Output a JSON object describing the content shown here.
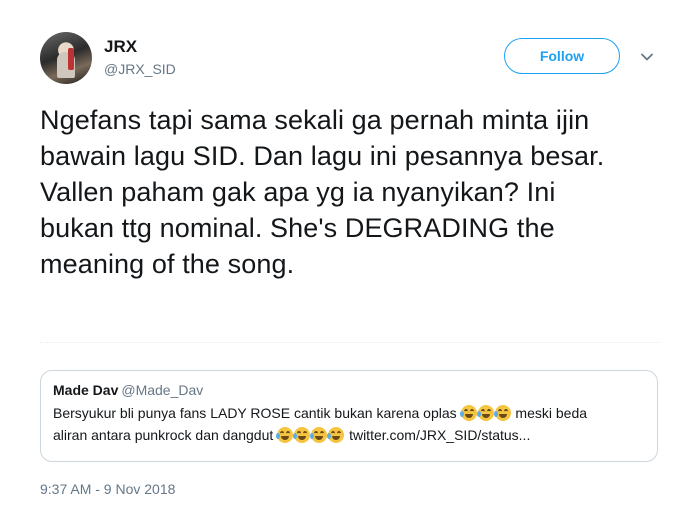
{
  "author": {
    "display_name": "JRX",
    "handle": "@JRX_SID",
    "avatar_icon": "profile-photo"
  },
  "header": {
    "follow_label": "Follow",
    "menu_icon": "chevron-down-icon"
  },
  "tweet": {
    "lines": [
      "Ngefans tapi sama sekali ga pernah minta ijin",
      "bawain lagu SID. Dan lagu ini pesannya besar.",
      "Vallen paham gak apa yg ia nyanyikan? Ini",
      "bukan ttg nominal. She's DEGRADING the",
      "meaning of the song."
    ]
  },
  "quoted_tweet": {
    "name": "Made Dav",
    "handle": "@Made_Dav",
    "line1_text": "Bersyukur bli punya fans LADY ROSE cantik bukan karena oplas",
    "line1_tail": "meski beda",
    "line2_text": "aliran antara punkrock dan dangdut",
    "line2_link": "twitter.com/JRX_SID/status...",
    "emoji_icon": "face-with-tears-of-joy-icon"
  },
  "timestamp": "9:37 AM - 9 Nov 2018",
  "colors": {
    "accent": "#1da1f2",
    "text": "#14171a",
    "secondary": "#657786",
    "border": "#ccd6dd"
  }
}
